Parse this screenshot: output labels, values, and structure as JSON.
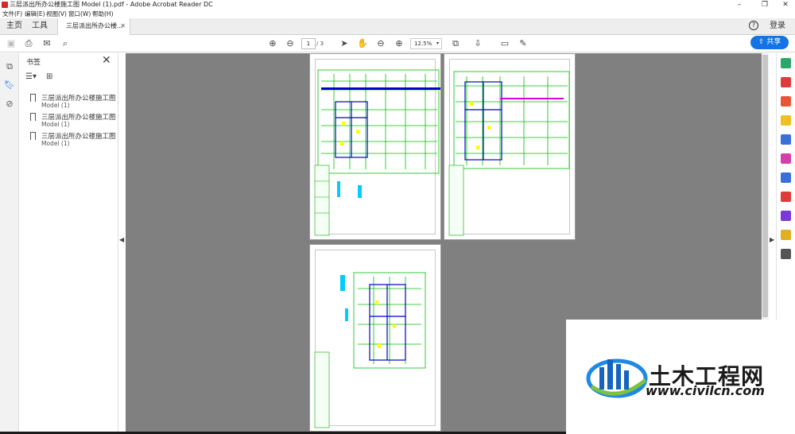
{
  "window": {
    "title": "三层派出所办公楼施工图 Model (1).pdf - Adobe Acrobat Reader DC"
  },
  "menu": [
    "文件(F)",
    "编辑(E)",
    "视图(V)",
    "窗口(W)",
    "帮助(H)"
  ],
  "tabs": {
    "home": "主页",
    "tools": "工具",
    "document": "三层派出所办公楼...",
    "login": "登录"
  },
  "toolbar": {
    "current_page": "1",
    "total_pages": "/ 3",
    "zoom": "12.5%",
    "share_label": "共享"
  },
  "bookmarks": {
    "title": "书签",
    "items": [
      {
        "label": "三层派出所办公楼施工图",
        "sub": "Model (1)"
      },
      {
        "label": "三层派出所办公楼施工图",
        "sub": "Model (1)"
      },
      {
        "label": "三层派出所办公楼施工图",
        "sub": "Model (1)"
      }
    ]
  },
  "watermark": {
    "brand": "土木工程网",
    "url": "www.civilcn.com"
  },
  "colors": {
    "accent": "#1473e6",
    "doc_background": "#808080",
    "drawing_green": "#00c000",
    "drawing_yellow": "#ffff00",
    "drawing_blue": "#0000cc",
    "drawing_magenta": "#e000e0"
  },
  "icons": {
    "app": "acrobat-icon",
    "help": "help-icon",
    "share": "share-icon"
  }
}
